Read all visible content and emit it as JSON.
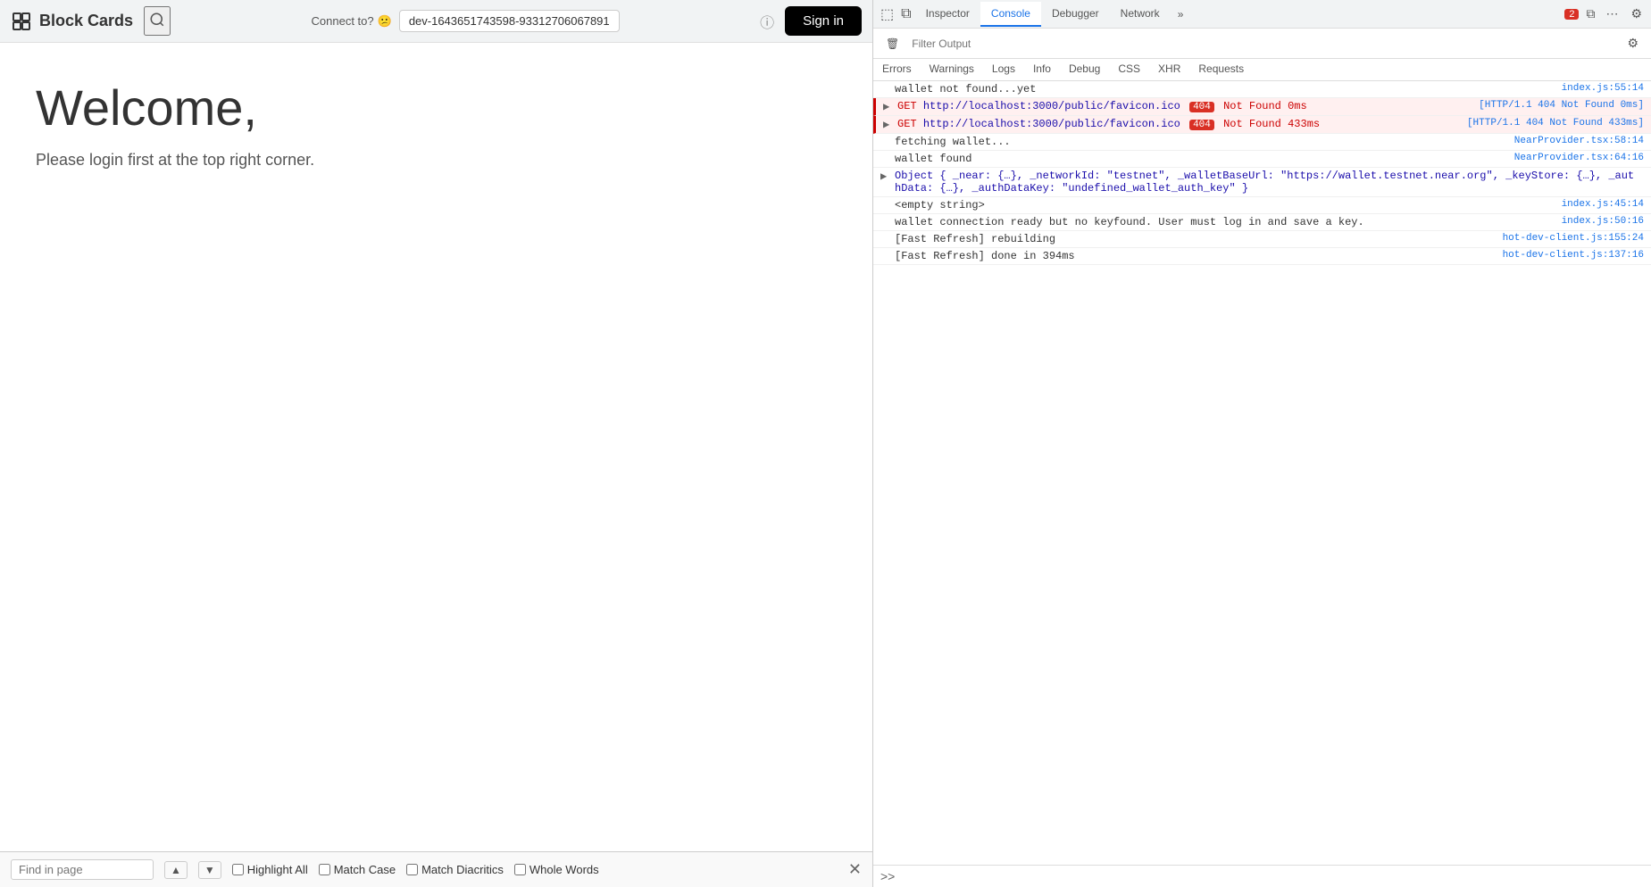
{
  "browser": {
    "logo_text": "Block Cards",
    "connect_to_label": "Connect to?",
    "url": "dev-1643651743598-93312706067891",
    "sign_in_label": "Sign in"
  },
  "page": {
    "welcome_title": "Welcome,",
    "welcome_subtitle": "Please login first at the top right corner."
  },
  "find_bar": {
    "placeholder": "Find in page",
    "highlight_all_label": "Highlight All",
    "match_case_label": "Match Case",
    "match_diacritics_label": "Match Diacritics",
    "whole_words_label": "Whole Words"
  },
  "devtools": {
    "tabs": [
      {
        "id": "inspector",
        "label": "Inspector",
        "active": false
      },
      {
        "id": "console",
        "label": "Console",
        "active": true
      },
      {
        "id": "debugger",
        "label": "Debugger",
        "active": false
      },
      {
        "id": "network",
        "label": "Network",
        "active": false
      }
    ],
    "error_count": "2",
    "filter_placeholder": "Filter Output",
    "console_filters": [
      {
        "id": "errors",
        "label": "Errors",
        "active": false
      },
      {
        "id": "warnings",
        "label": "Warnings",
        "active": false
      },
      {
        "id": "logs",
        "label": "Logs",
        "active": false
      },
      {
        "id": "info",
        "label": "Info",
        "active": false
      },
      {
        "id": "debug",
        "label": "Debug",
        "active": false
      },
      {
        "id": "css",
        "label": "CSS",
        "active": false
      },
      {
        "id": "xhr",
        "label": "XHR",
        "active": false
      },
      {
        "id": "requests",
        "label": "Requests",
        "active": false
      }
    ],
    "console_entries": [
      {
        "type": "log",
        "has_arrow": false,
        "message": "wallet not found...yet",
        "source": "index.js:55:14"
      },
      {
        "type": "error",
        "has_arrow": true,
        "message": "GET http://localhost:3000/public/favicon.ico",
        "http_status": "404",
        "status_text": "Not Found 0ms",
        "source": "[HTTP/1.1 404 Not Found 0ms]"
      },
      {
        "type": "error",
        "has_arrow": true,
        "message": "GET http://localhost:3000/public/favicon.ico",
        "http_status": "404",
        "status_text": "Not Found 433ms",
        "source": "[HTTP/1.1 404 Not Found 433ms]"
      },
      {
        "type": "log",
        "has_arrow": false,
        "message": "fetching wallet...",
        "source": "NearProvider.tsx:58:14"
      },
      {
        "type": "log",
        "has_arrow": false,
        "message": "wallet found",
        "source": "NearProvider.tsx:64:16"
      },
      {
        "type": "log",
        "has_arrow": true,
        "object_text": "Object { _near: {…}, _networkId: \"testnet\", _walletBaseUrl: \"https://wallet.testnet.near.org\", _keyStore: {…}, _authData: {…}, _authDataKey: \"undefined_wallet_auth_key\" }",
        "source": ""
      },
      {
        "type": "log",
        "has_arrow": false,
        "message": "<empty string>",
        "source": "index.js:45:14"
      },
      {
        "type": "log",
        "has_arrow": false,
        "message": "wallet connection ready but no keyfound. User must log in and save a key.",
        "source": "index.js:50:16"
      },
      {
        "type": "log",
        "has_arrow": false,
        "message": "[Fast Refresh] rebuilding",
        "source": "hot-dev-client.js:155:24"
      },
      {
        "type": "log",
        "has_arrow": false,
        "message": "[Fast Refresh] done in 394ms",
        "source": "hot-dev-client.js:137:16"
      }
    ]
  }
}
